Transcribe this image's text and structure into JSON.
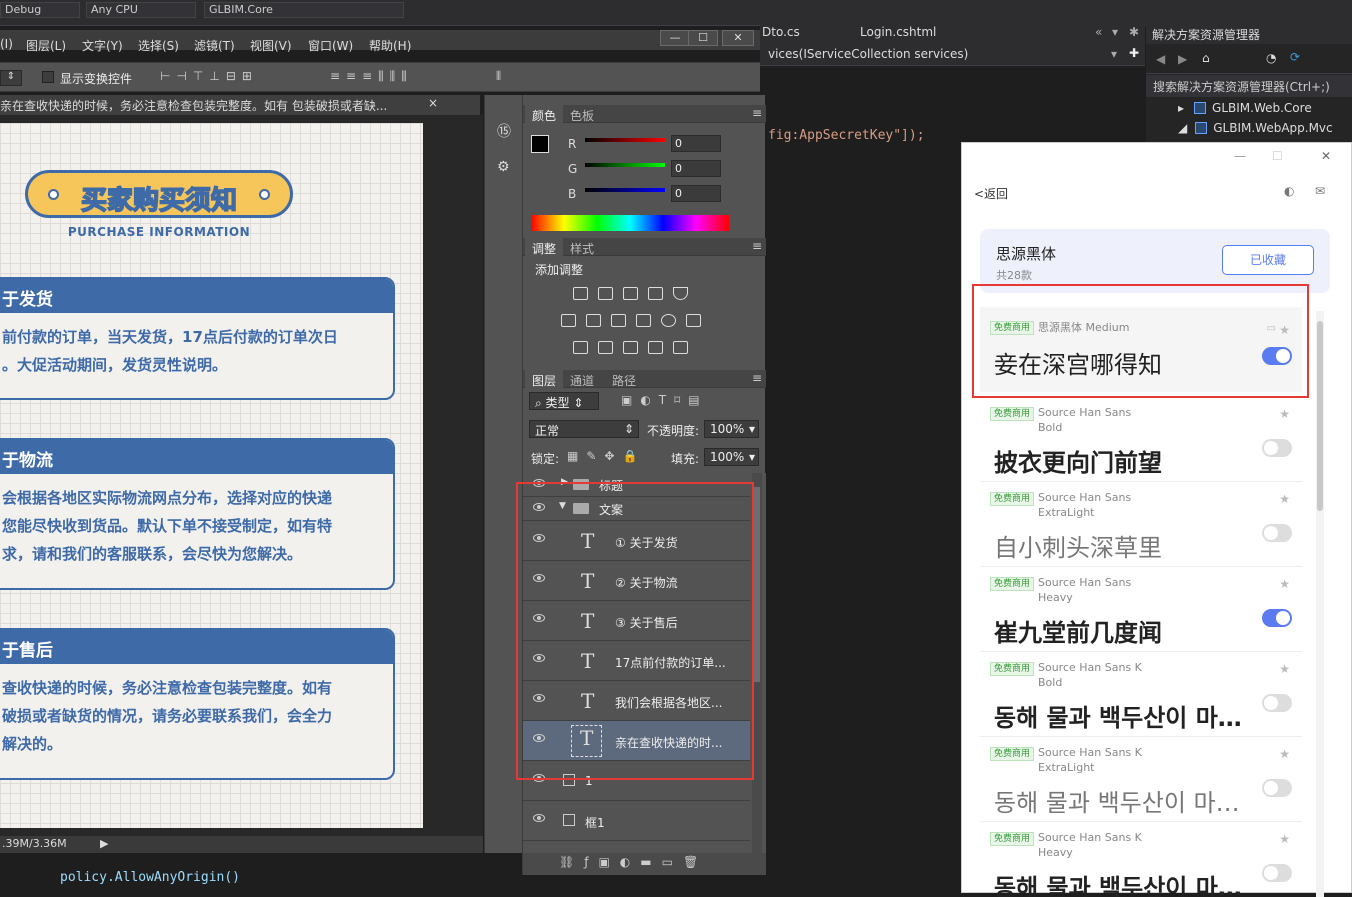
{
  "vs": {
    "toolbar": {
      "config": "Debug",
      "platform": "Any CPU",
      "startup": "GLBIM.Core"
    },
    "tabs": [
      "Dto.cs",
      "Login.cshtml"
    ],
    "signature": "vices(IServiceCollection services)",
    "code_line": "fig:AppSecretKey\"]);",
    "bottom_code": "policy.AllowAnyOrigin()",
    "solution_explorer": {
      "title": "解决方案资源管理器",
      "search_placeholder": "搜索解决方案资源管理器(Ctrl+;)",
      "items": [
        "GLBIM.Web.Core",
        "GLBIM.WebApp.Mvc"
      ]
    }
  },
  "ps": {
    "menu": [
      "(I)",
      "图层(L)",
      "文字(Y)",
      "选择(S)",
      "滤镜(T)",
      "视图(V)",
      "窗口(W)",
      "帮助(H)"
    ],
    "window_buttons": [
      "—",
      "☐",
      "✕"
    ],
    "options": {
      "show_transform": "显示变换控件"
    },
    "doc_tab": "亲在查收快递的时候，务必注意检查包装完整度。如有 包装破损或者缺...",
    "doc_close": "×",
    "status": ".39M/3.36M",
    "color_panel": {
      "tabs": [
        "颜色",
        "色板"
      ],
      "channels": [
        {
          "label": "R",
          "value": "0"
        },
        {
          "label": "G",
          "value": "0"
        },
        {
          "label": "B",
          "value": "0"
        }
      ]
    },
    "adjust_panel": {
      "tabs": [
        "调整",
        "样式"
      ],
      "title": "添加调整"
    },
    "layers_panel": {
      "tabs": [
        "图层",
        "通道",
        "路径"
      ],
      "filter": "类型",
      "blend_mode": "正常",
      "opacity_label": "不透明度:",
      "opacity": "100%",
      "lock_label": "锁定:",
      "fill_label": "填充:",
      "fill": "100%",
      "layers": [
        {
          "name": "标题",
          "kind": "group"
        },
        {
          "name": "文案",
          "kind": "group-open"
        },
        {
          "name": "① 关于发货",
          "kind": "text"
        },
        {
          "name": "② 关于物流",
          "kind": "text"
        },
        {
          "name": "③ 关于售后",
          "kind": "text"
        },
        {
          "name": "17点前付款的订单...",
          "kind": "text"
        },
        {
          "name": "我们会根据各地区...",
          "kind": "text"
        },
        {
          "name": "亲在查收快递的时...",
          "kind": "text-selected"
        },
        {
          "name": "1",
          "kind": "shape"
        },
        {
          "name": "框1",
          "kind": "shape"
        }
      ]
    }
  },
  "design": {
    "title": "买家购买须知",
    "subtitle": "PURCHASE INFORMATION",
    "cards": [
      {
        "heading": "于发货",
        "lines": [
          "前付款的订单，当天发货，17点后付款的订单次日",
          "。大促活动期间，发货灵性说明。"
        ]
      },
      {
        "heading": "于物流",
        "lines": [
          "会根据各地区实际物流网点分布，选择对应的快递",
          "您能尽快收到货品。默认下单不接受制定，如有特",
          "求，请和我们的客服联系，会尽快为您解决。"
        ]
      },
      {
        "heading": "于售后",
        "lines": [
          "查收快递的时候，务必注意检查包装完整度。如有",
          "破损或者缺货的情况，请务必要联系我们，会全力",
          "解决的。"
        ]
      }
    ]
  },
  "font_app": {
    "back": "<返回",
    "collection": {
      "name": "思源黑体",
      "count": "共28款",
      "button": "已收藏"
    },
    "fonts": [
      {
        "badge": "免费商用",
        "name": "思源黑体 Medium",
        "weight": "",
        "sample": "妾在深宫哪得知",
        "enabled": true
      },
      {
        "badge": "免费商用",
        "name": "Source Han Sans",
        "weight": "Bold",
        "sample": "披衣更向门前望",
        "enabled": false
      },
      {
        "badge": "免费商用",
        "name": "Source Han Sans",
        "weight": "ExtraLight",
        "sample": "自小刺头深草里",
        "enabled": false
      },
      {
        "badge": "免费商用",
        "name": "Source Han Sans",
        "weight": "Heavy",
        "sample": "崔九堂前几度闻",
        "enabled": true
      },
      {
        "badge": "免费商用",
        "name": "Source Han Sans K",
        "weight": "Bold",
        "sample": "동해 물과 백두산이 마…",
        "enabled": false
      },
      {
        "badge": "免费商用",
        "name": "Source Han Sans K",
        "weight": "ExtraLight",
        "sample": "동해 물과 백두산이 마…",
        "enabled": false
      },
      {
        "badge": "免费商用",
        "name": "Source Han Sans K",
        "weight": "Heavy",
        "sample": "동해 물과 백두산이 마…",
        "enabled": false
      }
    ]
  }
}
